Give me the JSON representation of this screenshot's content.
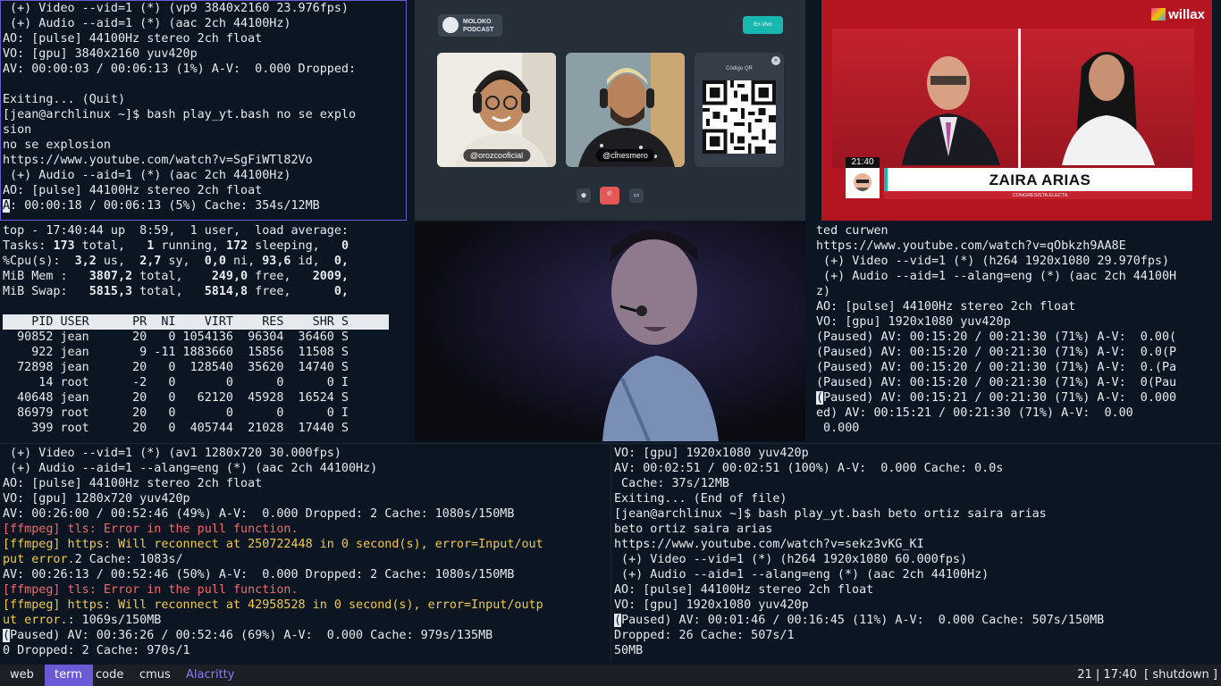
{
  "panes": {
    "top_left": [
      " (+) Video --vid=1 (*) (vp9 3840x2160 23.976fps)",
      " (+) Audio --aid=1 (*) (aac 2ch 44100Hz)",
      "AO: [pulse] 44100Hz stereo 2ch float",
      "VO: [gpu] 3840x2160 yuv420p",
      "AV: 00:00:03 / 00:06:13 (1%) A-V:  0.000 Dropped:",
      "",
      "Exiting... (Quit)",
      "[jean@archlinux ~]$ bash play_yt.bash no se explo",
      "sion",
      "no se explosion",
      "https://www.youtube.com/watch?v=SgFiWTl82Vo",
      " (+) Audio --aid=1 (*) (aac 2ch 44100Hz)",
      "AO: [pulse] 44100Hz stereo 2ch float"
    ],
    "top_left_cursor_char": "A",
    "top_left_last": ": 00:00:18 / 00:06:13 (5%) Cache: 354s/12MB",
    "top_stats": [
      "top - 17:40:44 up  8:59,  1 user,  load average:",
      [
        "Tasks: ",
        "173",
        " total,   ",
        "1",
        " running, ",
        "172",
        " sleeping,   ",
        "0"
      ],
      [
        "%Cpu(s):  ",
        "3,2",
        " us,  ",
        "2,7",
        " sy,  ",
        "0,0",
        " ni, ",
        "93,6",
        " id,  ",
        "0,"
      ],
      [
        "MiB Mem :   ",
        "3807,2",
        " total,    ",
        "249,0",
        " free,   ",
        "2009,"
      ],
      [
        "MiB Swap:   ",
        "5815,3",
        " total,   ",
        "5814,8",
        " free,      ",
        "0,"
      ]
    ],
    "top_header": "    PID USER      PR  NI    VIRT    RES    SHR S",
    "top_rows": [
      "  90852 jean      20   0 1054136  96304  36460 S",
      "    922 jean       9 -11 1883660  15856  11508 S",
      "  72898 jean      20   0  128540  35620  14740 S",
      "     14 root      -2   0       0      0      0 I",
      "  40648 jean      20   0   62120  45928  16524 S",
      "  86979 root      20   0       0      0      0 I",
      "    399 root      20   0  405744  21028  17440 S"
    ],
    "mid_right": [
      "ted curwen",
      "https://www.youtube.com/watch?v=qObkzh9AA8E",
      " (+) Video --vid=1 (*) (h264 1920x1080 29.970fps)",
      " (+) Audio --aid=1 --alang=eng (*) (aac 2ch 44100H",
      "z)",
      "AO: [pulse] 44100Hz stereo 2ch float",
      "VO: [gpu] 1920x1080 yuv420p",
      "(Paused) AV: 00:15:20 / 00:21:30 (71%) A-V:  0.00(",
      "(Paused) AV: 00:15:20 / 00:21:30 (71%) A-V:  0.0(P",
      "(Paused) AV: 00:15:20 / 00:21:30 (71%) A-V:  0.(Pa",
      "(Paused) AV: 00:15:20 / 00:21:30 (71%) A-V:  0(Pau"
    ],
    "mid_right_cursor_char": "(",
    "mid_right_cursor_rest": "Paused) AV: 00:15:21 / 00:21:30 (71%) A-V:  0.000",
    "mid_right_tail": [
      "ed) AV: 00:15:21 / 00:21:30 (71%) A-V:  0.00",
      " 0.000"
    ],
    "bottom_left": [
      {
        "t": " (+) Video --vid=1 (*) (av1 1280x720 30.000fps)",
        "c": ""
      },
      {
        "t": " (+) Audio --aid=1 --alang=eng (*) (aac 2ch 44100Hz)",
        "c": ""
      },
      {
        "t": "AO: [pulse] 44100Hz stereo 2ch float",
        "c": ""
      },
      {
        "t": "VO: [gpu] 1280x720 yuv420p",
        "c": ""
      },
      {
        "t": "AV: 00:26:00 / 00:52:46 (49%) A-V:  0.000 Dropped: 2 Cache: 1080s/150MB",
        "c": ""
      }
    ],
    "bl_ffmpeg_1": "[ffmpeg] tls: Error in the pull function.",
    "bl_ffmpeg_2a": "[ffmpeg] https: Will reconnect at 250722448 in 0 second(s), error=Input/out",
    "bl_ffmpeg_2b": "put error.",
    "bl_ffmpeg_2c": "2 Cache: 1083s/",
    "bl_line_9": "AV: 00:26:13 / 00:52:46 (50%) A-V:  0.000 Dropped: 2 Cache: 1080s/150MB",
    "bl_ffmpeg_3": "[ffmpeg] tls: Error in the pull function.",
    "bl_ffmpeg_4a": "[ffmpeg] https: Will reconnect at 42958528 in 0 second(s), error=Input/outp",
    "bl_ffmpeg_4b": "ut error.",
    "bl_ffmpeg_4c": ": 1069s/150MB",
    "bl_cursor_char": "(",
    "bl_cursor_rest": "Paused) AV: 00:36:26 / 00:52:46 (69%) A-V:  0.000 Cache: 979s/135MB",
    "bl_last": "0 Dropped: 2 Cache: 970s/1",
    "bottom_right": [
      "VO: [gpu] 1920x1080 yuv420p",
      "AV: 00:02:51 / 00:02:51 (100%) A-V:  0.000 Cache: 0.0s",
      " Cache: 37s/12MB",
      "Exiting... (End of file)",
      "[jean@archlinux ~]$ bash play_yt.bash beto ortiz saira arias",
      "beto ortiz saira arias",
      "https://www.youtube.com/watch?v=sekz3vKG_KI",
      " (+) Video --vid=1 (*) (h264 1920x1080 60.000fps)",
      " (+) Audio --aid=1 --alang=eng (*) (aac 2ch 44100Hz)",
      "AO: [pulse] 44100Hz stereo 2ch float",
      "VO: [gpu] 1920x1080 yuv420p"
    ],
    "br_cursor_char": "(",
    "br_cursor_rest": "Paused) AV: 00:01:46 / 00:16:45 (11%) A-V:  0.000 Cache: 507s/150MB",
    "br_tail": [
      "Dropped: 26 Cache: 507s/1",
      "50MB"
    ]
  },
  "call": {
    "logo_line1": "MOLOKO",
    "logo_line2": "PODCAST",
    "live_label": "En Vivo",
    "guest1": "@orozcooficial",
    "guest2": "@cinesmero",
    "qr_label": "Código QR",
    "qr_close": "×",
    "mic_icon": "mic-icon",
    "end_icon": "phone-hangup-icon",
    "cam_icon": "camera-icon"
  },
  "news": {
    "brand": "willax",
    "time": "21:40",
    "name": "ZAIRA ARIAS",
    "role": "CONGRESISTA ELECTA"
  },
  "statusbar": {
    "workspaces": [
      "web",
      "term",
      "code",
      "cmus"
    ],
    "active": "term",
    "window_title": "Alacritty",
    "right": "21 | 17:40  [ shutdown ]"
  },
  "colors": {
    "bg": "#0b1622",
    "focus_border": "#6a5ad6",
    "error": "#f0696b",
    "warning": "#f2c94c",
    "accent_teal": "#18b7b0",
    "news_red": "#b41520"
  }
}
